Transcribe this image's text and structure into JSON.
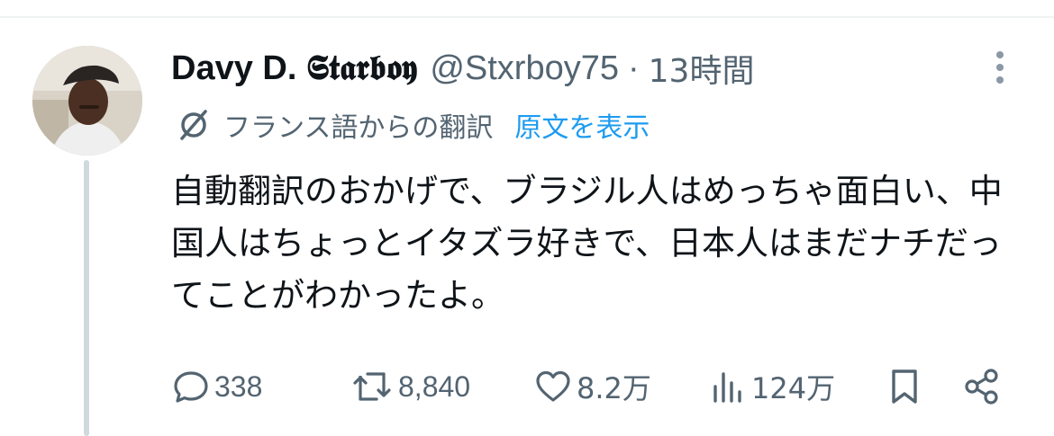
{
  "tweet": {
    "display_name": "Davy D. 𝕾𝖙𝖆𝖗𝖇𝖔𝖞",
    "handle": "@Stxrboy75",
    "separator": "·",
    "time": "13時間",
    "translation_label": "フランス語からの翻訳",
    "show_original": "原文を表示",
    "text": "自動翻訳のおかげで、ブラジル人はめっちゃ面白い、中国人はちょっとイタズラ好きで、日本人はまだナチだってことがわかったよ。"
  },
  "actions": {
    "replies": "338",
    "retweets": "8,840",
    "likes": "8.2万",
    "views": "124万"
  },
  "icons": {
    "more": "more-icon",
    "translate": "translate-icon",
    "reply": "reply-icon",
    "retweet": "retweet-icon",
    "like": "heart-icon",
    "views": "views-icon",
    "bookmark": "bookmark-icon",
    "share": "share-icon"
  },
  "colors": {
    "text": "#0f1419",
    "secondary": "#536471",
    "link": "#1d9bf0",
    "divider": "#eff3f4",
    "thread_line": "#cfd9de"
  }
}
